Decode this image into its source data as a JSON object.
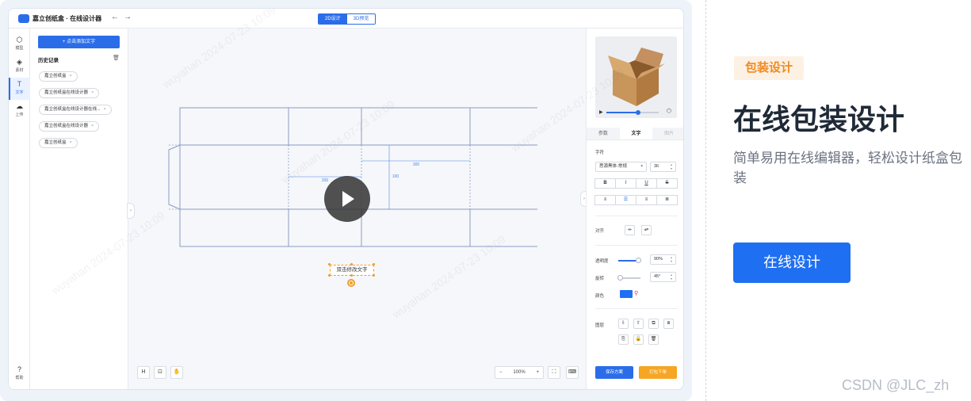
{
  "app": {
    "title": "嘉立创纸盒 · 在线设计器",
    "view_tabs": [
      "2D设计",
      "3D预览"
    ]
  },
  "rail": [
    {
      "label": "模型",
      "icon": "cube-icon",
      "glyph": "⬡"
    },
    {
      "label": "素材",
      "icon": "shapes-icon",
      "glyph": "◈"
    },
    {
      "label": "文字",
      "icon": "text-icon",
      "glyph": "T"
    },
    {
      "label": "上传",
      "icon": "cloud-upload-icon",
      "glyph": "☁"
    }
  ],
  "rail_help": {
    "label": "帮助",
    "glyph": "?"
  },
  "text_panel": {
    "add_button": "+ 点击添加文字",
    "history_title": "历史记录",
    "history": [
      "嘉立创纸盒",
      "嘉立创纸盒在线设计器",
      "嘉立创纸盒在线设计器在线...",
      "嘉立创纸盒在线设计器",
      "嘉立创纸盒"
    ]
  },
  "canvas": {
    "dims": {
      "d1": "200",
      "d2": "300",
      "d3": "100"
    },
    "text_object": "双击修改文字",
    "zoom": "100%",
    "zoom_minus": "−",
    "zoom_plus": "+",
    "tools": [
      "H",
      "⊡",
      "✋"
    ]
  },
  "right_panel": {
    "tabs": [
      "参数",
      "文字",
      "图片"
    ],
    "active_tab": "文字",
    "font_label": "字符",
    "font_family": "思源黑体-常规",
    "font_size": "36",
    "style_buttons": [
      "B",
      "I",
      "U",
      "S"
    ],
    "align_buttons": [
      "≡",
      "☰",
      "≡",
      "≣"
    ],
    "align_label": "对齐",
    "opacity_label": "透明度",
    "opacity_value": "90%",
    "opacity_level": 0.9,
    "rotate_label": "旋转",
    "rotate_value": "45°",
    "rotate_level": 0.1,
    "color_label": "颜色",
    "color_value": "#1f6ff2",
    "layer_label": "图层",
    "layer_buttons_row1": [
      "⇩",
      "⇧",
      "⧉",
      "⧈"
    ],
    "layer_buttons_row2": [
      "⎘",
      "🔓",
      "🗑"
    ],
    "save_button": "保存方案",
    "order_button": "打包下单"
  },
  "marketing": {
    "badge": "包装设计",
    "headline": "在线包装设计",
    "subline": "简单易用在线编辑器，轻松设计纸盒包装",
    "cta": "在线设计"
  },
  "credit": "CSDN @JLC_zh",
  "colors": {
    "accent": "#2b6de9",
    "orange": "#f6a623",
    "badge_text": "#f08a1f"
  }
}
